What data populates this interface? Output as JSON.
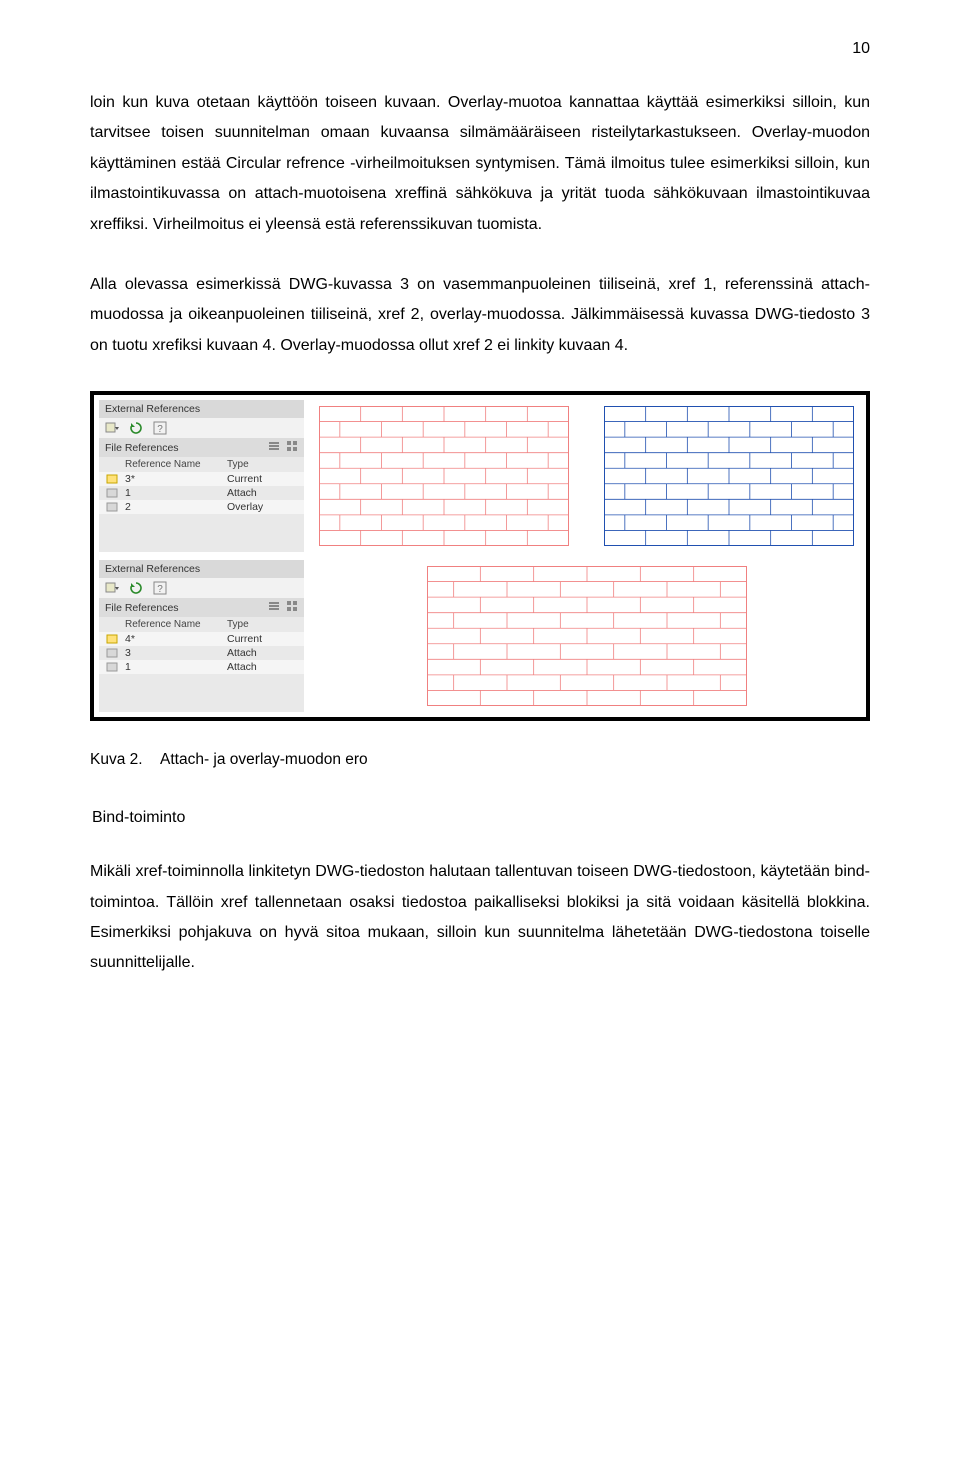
{
  "page_number": "10",
  "paragraphs": {
    "p1": "loin kun kuva otetaan käyttöön toiseen kuvaan. Overlay-muotoa kannattaa käyttää esimerkiksi silloin, kun tarvitsee toisen suunnitelman omaan kuvaansa silmämääräiseen risteilytarkastukseen. Overlay-muodon käyttäminen estää Circular refrence -virheilmoituksen syntymisen. Tämä ilmoitus tulee esimerkiksi silloin, kun ilmastointikuvassa on attach-muotoisena xreffinä sähkökuva ja yrität tuoda sähkökuvaan ilmastointikuvaa xreffiksi. Virheilmoitus ei yleensä estä referenssikuvan tuomista.",
    "p2": "Alla olevassa esimerkissä DWG-kuvassa 3 on vasemmanpuoleinen tiiliseinä, xref 1, referenssinä attach-muodossa ja oikeanpuoleinen tiiliseinä, xref 2, overlay-muodossa. Jälkimmäisessä kuvassa DWG-tiedosto 3 on tuotu xrefiksi kuvaan 4. Overlay-muodossa ollut xref 2 ei linkity kuvaan 4.",
    "p3": "Mikäli xref-toiminnolla linkitetyn DWG-tiedoston halutaan tallentuvan toiseen DWG-tiedostoon, käytetään bind-toimintoa. Tällöin xref tallennetaan osaksi tiedostoa paikalliseksi blokiksi ja sitä voidaan käsitellä blokkina. Esimerkiksi pohjakuva on hyvä sitoa mukaan, silloin kun suunnitelma lähetetään DWG-tiedostona toiselle suunnittelijalle."
  },
  "figure": {
    "title_top": "External References",
    "title_bottom": "External References",
    "section_title": "File References",
    "columns": {
      "name": "Reference Name",
      "type": "Type"
    },
    "rows_top": [
      {
        "icon": "dwg-current-icon",
        "name": "3*",
        "type": "Current"
      },
      {
        "icon": "dwg-attach-icon",
        "name": "1",
        "type": "Attach"
      },
      {
        "icon": "dwg-overlay-icon",
        "name": "2",
        "type": "Overlay"
      }
    ],
    "rows_bottom": [
      {
        "icon": "dwg-current-icon",
        "name": "4*",
        "type": "Current"
      },
      {
        "icon": "dwg-attach-icon",
        "name": "3",
        "type": "Attach"
      },
      {
        "icon": "dwg-attach-icon",
        "name": "1",
        "type": "Attach"
      }
    ],
    "toolbar_icons": {
      "attach_menu": "attach-dropdown-icon",
      "refresh_menu": "refresh-dropdown-icon",
      "help": "help-icon",
      "list_view": "list-view-icon",
      "details_view": "details-view-icon"
    },
    "wall_colors": {
      "red": "#f08080",
      "blue": "#2050b0"
    },
    "caption_label": "Kuva 2.",
    "caption_text": "Attach- ja overlay-muodon ero"
  },
  "subheading": "Bind-toiminto"
}
